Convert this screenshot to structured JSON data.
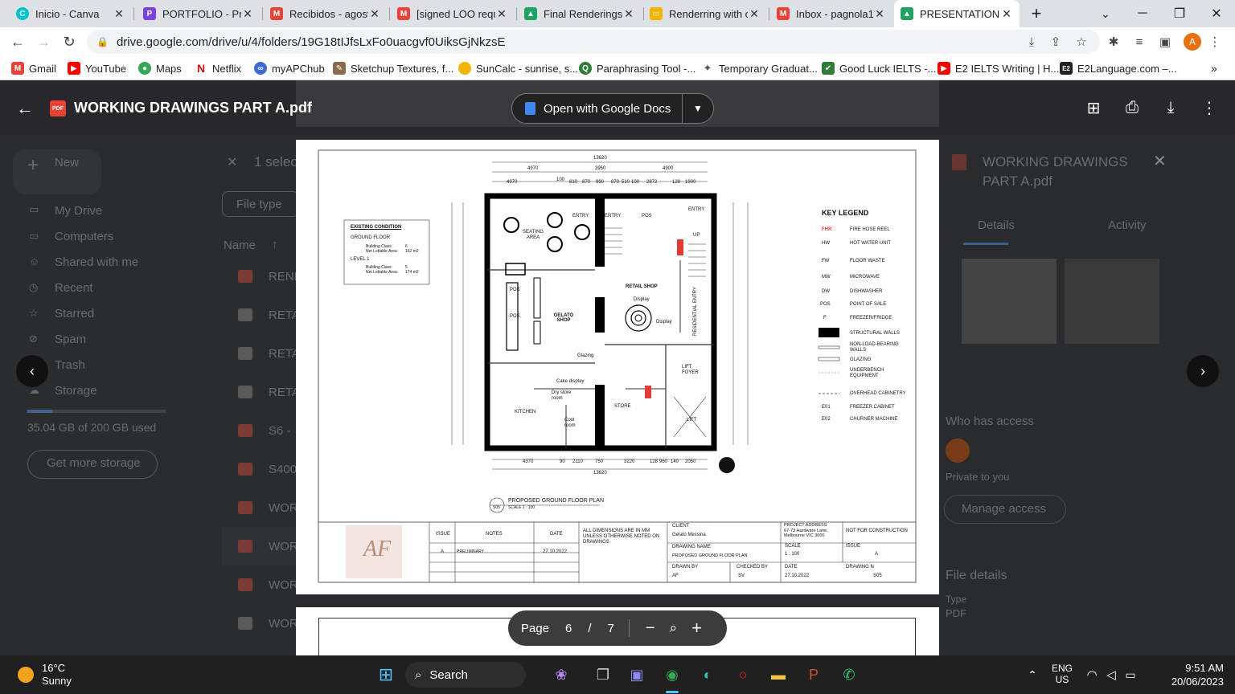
{
  "tabs": [
    {
      "title": "Inicio - Canva",
      "color": "#00c4cc",
      "glyph": "C"
    },
    {
      "title": "PORTFOLIO - Pre",
      "color": "#7b3fe4",
      "glyph": "P"
    },
    {
      "title": "Recibidos - agost",
      "color": "#ea4335",
      "glyph": "M"
    },
    {
      "title": "[signed LOO requ",
      "color": "#ea4335",
      "glyph": "M"
    },
    {
      "title": "Final Renderings",
      "color": "#1fa463",
      "glyph": "▲"
    },
    {
      "title": "Renderring with c",
      "color": "#f4b400",
      "glyph": "▭"
    },
    {
      "title": "Inbox - pagnola1",
      "color": "#ea4335",
      "glyph": "M"
    },
    {
      "title": "PRESENTATION -",
      "color": "#1fa463",
      "glyph": "▲"
    }
  ],
  "url": "drive.google.com/drive/u/4/folders/19G18tIJfsLxFo0uacgvf0UiksGjNkzsE",
  "avatar_letter": "A",
  "bookmarks": [
    {
      "label": "Gmail",
      "color": "#ea4335",
      "glyph": "M"
    },
    {
      "label": "YouTube",
      "color": "#ff0000",
      "glyph": "▶"
    },
    {
      "label": "Maps",
      "color": "#34a853",
      "glyph": "●"
    },
    {
      "label": "Netflix",
      "color": "#e50914",
      "glyph": "N"
    },
    {
      "label": "myAPChub",
      "color": "#3c6bd6",
      "glyph": "∞"
    },
    {
      "label": "Sketchup Textures, f...",
      "color": "#8a6a4a",
      "glyph": "✎"
    },
    {
      "label": "SunCalc - sunrise, s...",
      "color": "#f4b400",
      "glyph": "●"
    },
    {
      "label": "Paraphrasing Tool -...",
      "color": "#2e7d32",
      "glyph": "Q"
    },
    {
      "label": "Temporary Graduat...",
      "color": "#555",
      "glyph": "✦"
    },
    {
      "label": "Good Luck IELTS -...",
      "color": "#2e7d32",
      "glyph": "✔"
    },
    {
      "label": "E2 IELTS Writing | H...",
      "color": "#ff0000",
      "glyph": "▶"
    },
    {
      "label": "E2Language.com –...",
      "color": "#222",
      "glyph": "E2"
    }
  ],
  "viewer": {
    "file_title": "WORKING DRAWINGS PART A.pdf",
    "open_with": "Open with Google Docs",
    "page_label": "Page",
    "page_current": "6",
    "page_sep": "/",
    "page_total": "7"
  },
  "drive": {
    "new": "New",
    "selected": "1 selec",
    "file_type": "File type",
    "name_col": "Name",
    "nav": [
      "My Drive",
      "Computers",
      "Shared with me",
      "Recent",
      "Starred",
      "Spam",
      "Trash",
      "Storage"
    ],
    "storage": "35.04 GB of 200 GB used",
    "get_storage": "Get more storage",
    "files": [
      "REND",
      "RETA",
      "RETA",
      "RETA",
      "S6 -",
      "S400",
      "WOR",
      "WOR",
      "WOR",
      "WOR"
    ]
  },
  "details": {
    "title": "WORKING DRAWINGS PART A.pdf",
    "tab_details": "Details",
    "tab_activity": "Activity",
    "who_access": "Who has access",
    "private": "Private to you",
    "manage": "Manage access",
    "file_details": "File details",
    "type_label": "Type",
    "type_value": "PDF"
  },
  "drawing": {
    "existing_title": "EXISTING CONDITION",
    "ground_floor": "GROUND FLOOR",
    "bc1": "Building Class:",
    "bc1v": "6",
    "nla1": "Net Lettable Area:",
    "nla1v": "162 m2",
    "level1": "LEVEL 1",
    "bc2": "Building Class:",
    "bc2v": "5",
    "nla2": "Net Lettable Area:",
    "nla2v": "174 m2",
    "legend_title": "KEY LEGEND",
    "legend": [
      {
        "sym": "FHR",
        "text": "FIRE HOSE REEL"
      },
      {
        "sym": "HW",
        "text": "HOT WATER UNIT"
      },
      {
        "sym": "FW",
        "text": "FLOOR WASTE"
      },
      {
        "sym": "MW",
        "text": "MICROWAVE"
      },
      {
        "sym": "DW",
        "text": "DISHWASHER"
      },
      {
        "sym": "POS",
        "text": "POINT OF SALE"
      },
      {
        "sym": "F",
        "text": "FREEZER/FRIDGE"
      },
      {
        "sym": "",
        "text": "STRUCTURAL WALLS"
      },
      {
        "sym": "",
        "text": "NON-LOAD-BEARING WALLS"
      },
      {
        "sym": "",
        "text": "GLAZING"
      },
      {
        "sym": "",
        "text": "UNDERBENCH EQUIPMENT"
      },
      {
        "sym": "",
        "text": "OVERHEAD CABINETRY"
      },
      {
        "sym": "E01",
        "text": "FREEZER CABINET"
      },
      {
        "sym": "E02",
        "text": "CHURNER MACHINE"
      }
    ],
    "rooms": [
      {
        "label": "SEATING AREA"
      },
      {
        "label": "GELATO SHOP"
      },
      {
        "label": "RETAIL SHOP"
      },
      {
        "label": "KITCHEN"
      },
      {
        "label": "Dry store room"
      },
      {
        "label": "Cool room"
      },
      {
        "label": "STORE"
      },
      {
        "label": "LIFT FOYER"
      },
      {
        "label": "LIFT"
      },
      {
        "label": "ENTRY"
      },
      {
        "label": "ENTRY"
      },
      {
        "label": "ENTRY"
      },
      {
        "label": "RESIDENTIAL ENTRY"
      },
      {
        "label": "POS"
      },
      {
        "label": "POS"
      },
      {
        "label": "POS"
      },
      {
        "label": "Display"
      },
      {
        "label": "Display"
      },
      {
        "label": "Glazing"
      },
      {
        "label": "Cake display"
      },
      {
        "label": "UP"
      }
    ],
    "dims_top": [
      "13620",
      "4970",
      "3950",
      "4900",
      "4970",
      "100",
      "810",
      "870",
      "990",
      "870",
      "510",
      "100",
      "2872",
      "128",
      "1900"
    ],
    "dims_bottom": [
      "4370",
      "90",
      "2110",
      "750",
      "3220",
      "128",
      "960",
      "140",
      "2050",
      "13620"
    ],
    "plan_title": "PROPOSED GROUND FLOOR PLAN",
    "plan_scale": "SCALE 1 : 100",
    "plan_ref": "S05",
    "tb_issue": "ISSUE",
    "tb_notes": "NOTES",
    "tb_date": "DATE",
    "tb_row_issue": "A",
    "tb_row_notes": "PRELIMINARY",
    "tb_row_date": "27.10.2022",
    "tb_dims": "ALL DIMENSIONS ARE IN MM UNLESS OTHERWISE NOTED ON DRAWINGS",
    "client_label": "CLIENT",
    "client": "Gelato Messina",
    "address_label": "PROJECT ADDRESS",
    "address": "67-73 Hardware Lane, Melbourne VIC 3000",
    "nfc": "NOT FOR CONSTRUCTION",
    "dname_label": "DRAWING NAME",
    "dname": "PROPOSED GROUND FLOOR PLAN",
    "scale_label": "SCALE",
    "scale": "1 : 100",
    "issue_label": "ISSUE",
    "issue": "A",
    "drawn_label": "DRAWN BY",
    "drawn": "AF",
    "checked_label": "CHECKED BY",
    "checked": "SV",
    "date_label": "DATE",
    "date": "27.10.2022",
    "dno_label": "DRAWING N",
    "dno": "S05",
    "logo": "AF"
  },
  "taskbar": {
    "temp": "16°C",
    "weather": "Sunny",
    "search": "Search",
    "lang1": "ENG",
    "lang2": "US",
    "time": "9:51 AM",
    "date": "20/06/2023"
  }
}
